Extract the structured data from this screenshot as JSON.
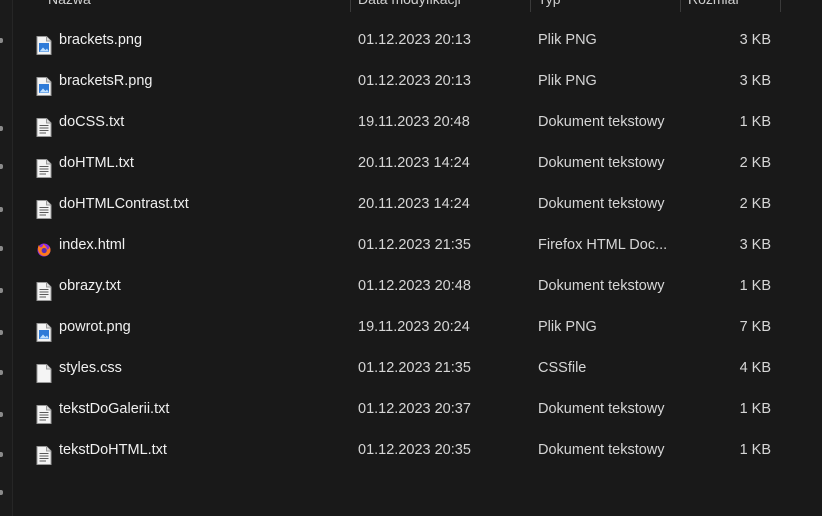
{
  "header": {
    "col_name": "Nazwa",
    "col_date": "Data modyfikacji",
    "col_type": "Typ",
    "col_size": "Rozmiar"
  },
  "files": [
    {
      "name": "brackets.png",
      "date": "01.12.2023 20:13",
      "type": "Plik PNG",
      "size": "3 KB",
      "icon": "png-image-icon"
    },
    {
      "name": "bracketsR.png",
      "date": "01.12.2023 20:13",
      "type": "Plik PNG",
      "size": "3 KB",
      "icon": "png-image-icon"
    },
    {
      "name": "doCSS.txt",
      "date": "19.11.2023 20:48",
      "type": "Dokument tekstowy",
      "size": "1 KB",
      "icon": "text-document-icon"
    },
    {
      "name": "doHTML.txt",
      "date": "20.11.2023 14:24",
      "type": "Dokument tekstowy",
      "size": "2 KB",
      "icon": "text-document-icon"
    },
    {
      "name": "doHTMLContrast.txt",
      "date": "20.11.2023 14:24",
      "type": "Dokument tekstowy",
      "size": "2 KB",
      "icon": "text-document-icon"
    },
    {
      "name": "index.html",
      "date": "01.12.2023 21:35",
      "type": "Firefox HTML Doc...",
      "size": "3 KB",
      "icon": "firefox-html-icon"
    },
    {
      "name": "obrazy.txt",
      "date": "01.12.2023 20:48",
      "type": "Dokument tekstowy",
      "size": "1 KB",
      "icon": "text-document-icon"
    },
    {
      "name": "powrot.png",
      "date": "19.11.2023 20:24",
      "type": "Plik PNG",
      "size": "7 KB",
      "icon": "png-image-icon"
    },
    {
      "name": "styles.css",
      "date": "01.12.2023 21:35",
      "type": "CSSfile",
      "size": "4 KB",
      "icon": "blank-file-icon"
    },
    {
      "name": "tekstDoGalerii.txt",
      "date": "01.12.2023 20:37",
      "type": "Dokument tekstowy",
      "size": "1 KB",
      "icon": "text-document-icon"
    },
    {
      "name": "tekstDoHTML.txt",
      "date": "01.12.2023 20:35",
      "type": "Dokument tekstowy",
      "size": "1 KB",
      "icon": "text-document-icon"
    }
  ],
  "colors": {
    "background": "#191919",
    "text": "#f0f0f0",
    "png_accent": "#2f7bd8",
    "firefox_orange": "#ff7a1a",
    "firefox_purple": "#8a2be2"
  }
}
